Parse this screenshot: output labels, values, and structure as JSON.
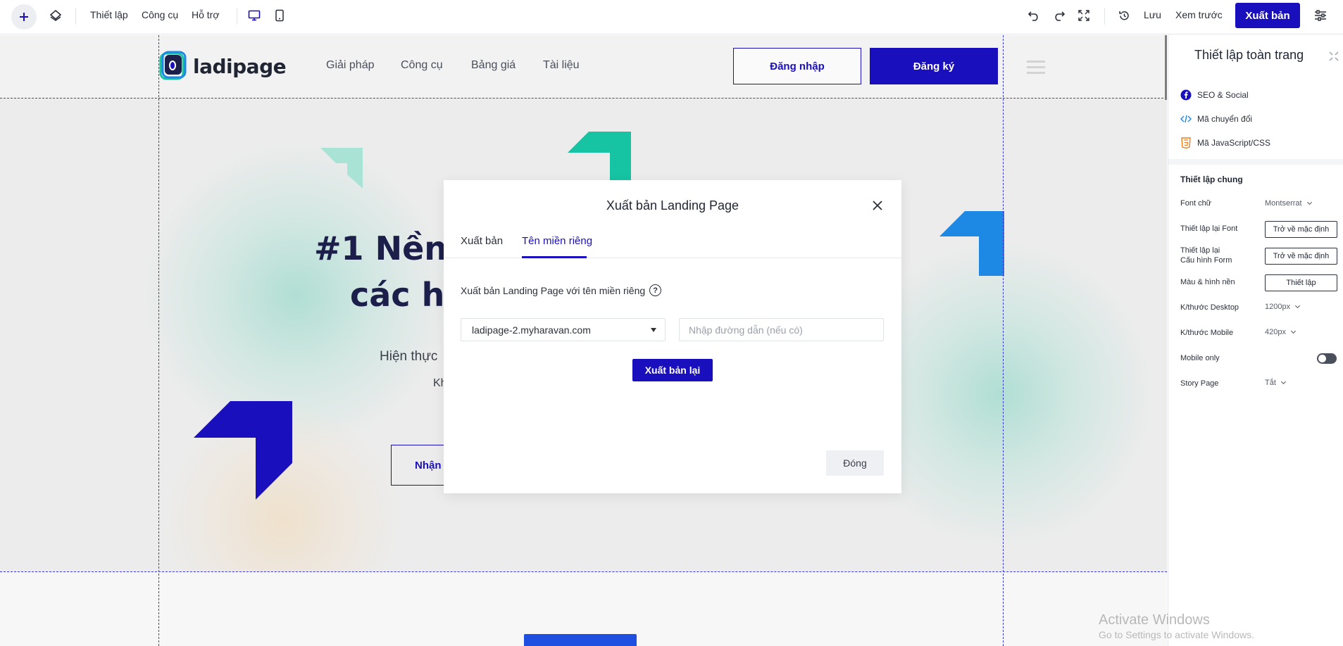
{
  "toolbar": {
    "add_icon": "plus-icon",
    "layers_icon": "layers-icon",
    "menus": [
      "Thiết lập",
      "Công cụ",
      "Hỗ trợ"
    ],
    "device_icons": [
      "desktop-icon",
      "mobile-icon"
    ],
    "history_icons": [
      "undo-icon",
      "redo-icon",
      "fullscreen-icon",
      "history-icon"
    ],
    "save_label": "Lưu",
    "preview_label": "Xem trước",
    "publish_label": "Xuất bản",
    "settings_icon": "sliders-icon",
    "accent_color": "#1a0fbd"
  },
  "site": {
    "logo_text": "ladipage",
    "nav": [
      "Giải pháp",
      "Công cụ",
      "Bảng giá",
      "Tài liệu"
    ],
    "login_label": "Đăng nhập",
    "signup_label": "Đăng ký",
    "hero_line1": "#1 Nền",
    "hero_line2": "các h",
    "hero_sub": "Hiện thực",
    "hero_sub2": "Kh",
    "hero_button": "Nhận"
  },
  "modal": {
    "title": "Xuất bản Landing Page",
    "tabs": [
      "Xuất bản",
      "Tên miền riêng"
    ],
    "active_tab": "Tên miền riêng",
    "label": "Xuất bản Landing Page với tên miền riêng",
    "domain_value": "ladipage-2.myharavan.com",
    "path_placeholder": "Nhập đường dẫn (nếu có)",
    "republish_label": "Xuất bản lại",
    "close_label": "Đóng"
  },
  "panel": {
    "title": "Thiết lập toàn trang",
    "links": [
      {
        "label": "SEO & Social",
        "icon": "facebook-icon"
      },
      {
        "label": "Mã chuyển đổi",
        "icon": "code-icon"
      },
      {
        "label": "Mã JavaScript/CSS",
        "icon": "html5-icon"
      }
    ],
    "section_title": "Thiết lập chung",
    "font_label": "Font chữ",
    "font_value": "Montserrat",
    "reset_font_label": "Thiết lập lại Font",
    "reset_font_btn": "Trở về mặc định",
    "reset_form_label_1": "Thiết lập lại",
    "reset_form_label_2": "Cấu hình Form",
    "reset_form_btn": "Trở về mặc định",
    "bg_label": "Màu & hình nền",
    "bg_btn": "Thiết lập",
    "desktop_label": "K/thước Desktop",
    "desktop_value": "1200px",
    "mobile_size_label": "K/thước Mobile",
    "mobile_size_value": "420px",
    "mobile_only_label": "Mobile only",
    "mobile_only_on": false,
    "story_label": "Story Page",
    "story_value": "Tắt"
  },
  "watermark": {
    "line1": "Activate Windows",
    "line2": "Go to Settings to activate Windows."
  }
}
